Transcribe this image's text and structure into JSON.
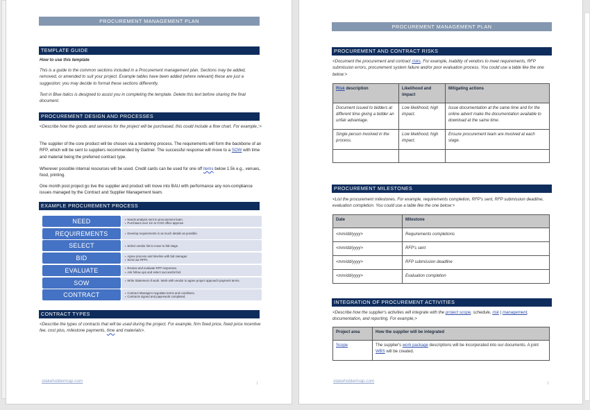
{
  "document": {
    "header_title": "PROCUREMENT MANAGEMENT PLAN",
    "footer_link": "stakeholdermap.com",
    "accent_color": "#0f2d5c",
    "header_color": "#8497b0",
    "process_color": "#4472c4"
  },
  "page1": {
    "page_number": "1",
    "template_guide": {
      "heading": "TEMPLATE GUIDE",
      "subheading": "How to use this template",
      "para1": "This is a guide to the common sections included in a Procurement management plan. Sections may be added, removed, or amended to suit your project. Example tables have been added (where relevant) these are just a suggestion; you may decide to format these sections differently.",
      "para2": "Text in Blue italics is designed to assist you in completing the template. Delete this text before sharing the final document."
    },
    "design": {
      "heading": "PROCUREMENT DESIGN AND PROCESSES",
      "prompt": "<Describe how the goods and services for the project will be purchased, this could include a flow chart. For example,:>",
      "para1_a": "The supplier of the core product will be chosen via a tendering process. The requirements will form the backbone of an RFP, which will be sent to suppliers recommended by Gartner. The successful response will move to a ",
      "para1_link": "SOW",
      "para1_b": " with time and material being the preferred contract type.",
      "para2_a": "Wherever possible internal resources will be used. Credit cards can be used for one off ",
      "para2_link": "items",
      "para2_b": " below 1.5k e.g., venues, food, printing.",
      "para3": "One month post project go live the supplier and product will move into BAU with performance any non-compliance issues managed by the Contract and Supplier Management team."
    },
    "process": {
      "heading": "EXAMPLE PROCUREMENT PROCESS",
      "steps": [
        {
          "label": "NEED",
          "bullets": [
            "Needs analysis sent to procurement team.",
            "Purchases over 1m to COO office approve"
          ]
        },
        {
          "label": "REQUIREMENTS",
          "bullets": [
            "Develop requirements in as much details as possible."
          ]
        },
        {
          "label": "SELECT",
          "bullets": [
            "Select vendor list to move to bid stage."
          ]
        },
        {
          "label": "BID",
          "bullets": [
            "Agree process and timeline with bid manager.",
            "Send out RFPs"
          ]
        },
        {
          "label": "EVALUATE",
          "bullets": [
            "Review and evaluate RFP responses.",
            "Ask follow ups and select successful bid."
          ]
        },
        {
          "label": "SOW",
          "bullets": [
            "Write Statement of work. Work with vendor to agree project approach payment terms."
          ]
        },
        {
          "label": "CONTRACT",
          "bullets": [
            "Contract Managers negotiate terms and conditions.",
            "Contracts signed and paperwork completed."
          ]
        }
      ]
    },
    "contract_types": {
      "heading": "CONTRACT TYPES",
      "prompt_a": "<Describe the types of contracts that will be used during the project. For example, firm fixed price, fixed price incentive fee, cost plus, milestone payments, ",
      "prompt_link": "time",
      "prompt_b": " and materials>."
    }
  },
  "page2": {
    "page_number": "2",
    "risks": {
      "heading": "PROCUREMENT AND CONTRACT RISKS",
      "prompt_a": "<Document the procurement and contract ",
      "prompt_link": "risks",
      "prompt_b": ". For example, inability of vendors to meet requirements, RFP submission errors, procurement system failure and/or poor evaluation process. You could use a table like the one below:>",
      "columns": {
        "c1_link": "Risk",
        "c1_rest": " description",
        "c2": "Likelihood and impact",
        "c3": "Mitigating actions"
      },
      "rows": [
        [
          "Document issued to bidders at different time giving a bidder an unfair advantage.",
          "Low likelihood, high impact.",
          "Issue documentation at the same time and for the online advert make the documentation available to download at the same time."
        ],
        [
          "Single person involved in the process.",
          "Low likelihood, high impact.",
          "Ensure procurement team are involved at each stage."
        ],
        [
          "",
          "",
          ""
        ]
      ]
    },
    "milestones": {
      "heading": "PROCUREMENT MILESTONES",
      "prompt": "<List the procurement milestones. For example, requirements completion, RFP's sent, RFP submission deadline, evaluation completion. You could use a table like the one below:>",
      "columns": [
        "Date",
        "Milestone"
      ],
      "rows": [
        [
          "<mm/dd/yyyy>",
          "Requirements completions"
        ],
        [
          "<mm/dd/yyyy>",
          "RFP's sent"
        ],
        [
          "<mm/dd/yyyy>",
          "RFP submission deadline"
        ],
        [
          "<mm/dd/yyyy>",
          "Evaluation completion"
        ]
      ]
    },
    "integration": {
      "heading": "INTEGRATION OF PROCUREMENT ACTIVITIES",
      "prompt_a": "<Describe how the supplier's activities will integrate with the ",
      "prompt_link1": "project scope",
      "prompt_b": ", schedule, ",
      "prompt_link2": "risk",
      "prompt_link3": "management",
      "prompt_c": ", documentation, and reporting. For example,>",
      "columns": [
        "Project area",
        "How the supplier will be integrated"
      ],
      "row_area": "Scope",
      "row_a": "The supplier's ",
      "row_link1": "work package",
      "row_b": " descriptions will be incorporated into our documents. A joint ",
      "row_link2": "WBS",
      "row_c": " will be created."
    }
  }
}
